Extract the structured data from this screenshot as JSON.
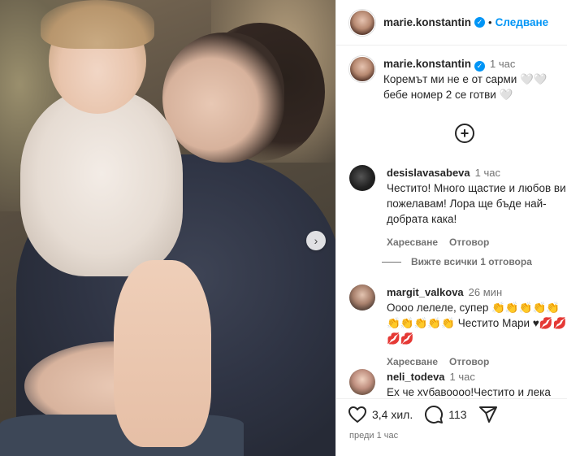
{
  "post": {
    "username": "marie.konstantin",
    "follow_label": "Следване",
    "caption_time": "1 час",
    "caption_text": "Коремът ми не е от сарми 🤍🤍 бебе номер 2 се готви 🤍",
    "likes": "3,4 хил.",
    "comment_count": "113",
    "date": "преди 1 час"
  },
  "comments": [
    {
      "username": "desislavasabeva",
      "time": "1 час",
      "text": "Честито! Много щастие и любов ви пожелавам! Лора ще бъде най-добрата кака!",
      "like_label": "Харесване",
      "reply_label": "Отговор",
      "view_replies": "Вижте всички 1 отговора"
    },
    {
      "username": "margit_valkova",
      "time": "26 мин",
      "text": "Оооо лелеле, супер 👏👏👏👏👏👏👏👏👏👏 Честито Мари ♥💋💋💋💋",
      "like_label": "Харесване",
      "reply_label": "Отговор"
    },
    {
      "username": "neli_todeva",
      "time": "1 час",
      "text": "Ех че хубавоооо!Честито и лека"
    }
  ],
  "icons": {
    "verified": "verified-badge-icon",
    "add_comment": "plus-circle-icon",
    "like": "heart-icon",
    "comment": "comment-icon",
    "share": "send-icon",
    "next": "chevron-right-icon"
  },
  "colors": {
    "accent": "#0095f6",
    "secondary_text": "#737373"
  }
}
